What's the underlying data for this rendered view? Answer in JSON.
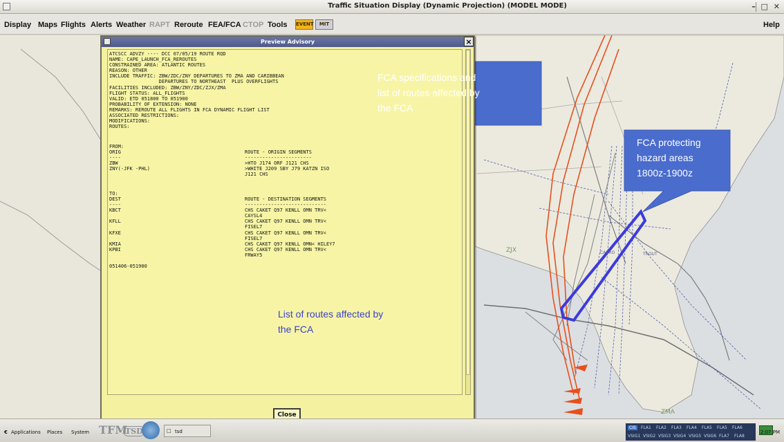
{
  "window": {
    "title": "Traffic Situation Display (Dynamic Projection) (MODEL MODE)",
    "controls": "– □ ✕"
  },
  "menubar": {
    "items": [
      {
        "label": "Display",
        "disabled": false
      },
      {
        "label": "Maps",
        "disabled": false
      },
      {
        "label": "Flights",
        "disabled": false
      },
      {
        "label": "Alerts",
        "disabled": false
      },
      {
        "label": "Weather",
        "disabled": false
      },
      {
        "label": "RAPT",
        "disabled": true
      },
      {
        "label": "Reroute",
        "disabled": false
      },
      {
        "label": "FEA/FCA",
        "disabled": false
      },
      {
        "label": "CTOP",
        "disabled": true
      },
      {
        "label": "Tools",
        "disabled": false
      }
    ],
    "tool_buttons": [
      "EVENT",
      "MIT"
    ],
    "help": "Help"
  },
  "advisory": {
    "title": "Preview Advisory",
    "header_text": "ATCSCC ADVZY ---- DCC 07/05/19 ROUTE RQD\nNAME: CAPE_LAUNCH_FCA_REROUTES\nCONSTRAINED AREA: ATLANTIC ROUTES\nREASON: OTHER\nINCLUDE TRAFFIC: ZBW/ZDC/ZNY DEPARTURES TO ZMA AND CARIBBEAN\n                 DEPARTURES TO NORTHEAST  PLUS OVERFLIGHTS\nFACILITIES INCLUDED: ZBW/ZNY/ZDC/ZJX/ZMA\nFLIGHT STATUS: ALL_FLIGHTS\nVALID: ETD 051800 TO 051900\nPROBABILITY OF EXTENSION: NONE\nREMARKS: REROUTE ALL FLIGHTS IN FCA DYNAMIC FLIGHT LIST\nASSOCIATED RESTRICTIONS:\nMODIFICATIONS:\nROUTES:",
    "from_text": "FROM:\nORIG\n----\nZBW\nZNY(-JFK -PHL)",
    "origin_routes_text": "ROUTE - ORIGIN SEGMENTS\n-----------------------\n>HTO J174 ORF J121 CHS\n>WHITE J209 SBY J79 KATZN ISO\nJ121 CHS",
    "to_text": "TO:\nDEST\n----\nKBCT\n\nKFLL\n\nKFXE\n\nKMIA\nKPBI\n\n\n051406-051900",
    "dest_routes_text": "ROUTE - DESTINATION SEGMENTS\n----------------------------\nCHS CAKET Q97 KENLL OMN TRV<\nCAYSL4\nCHS CAKET Q97 KENLL OMN TRV<\nFISEL7\nCHS CAKET Q97 KENLL OMN TRV<\nFISEL7\nCHS CAKET Q97 KENLL OMN< HILEY7\nCHS CAKET Q97 KENLL OMN TRV<\nFRWAY5",
    "close_label": "Close"
  },
  "callouts": {
    "spec": "FCA specifications and\nlist of routes affected by\nthe FCA",
    "hazard": "FCA protecting\nhazard areas\n1800z-1900z",
    "routes": "List of routes affected by\nthe FCA"
  },
  "map_labels": [
    "ZJX",
    "ZMA",
    "TROUT",
    "CABRO"
  ],
  "colors": {
    "advisory_bg": "#f4f2a0",
    "callout_blue": "#4a6ccd",
    "fca_box": "#3b3bdc",
    "route_orange": "#e5501d"
  },
  "taskbar": {
    "menus": [
      "Applications",
      "Places",
      "System"
    ],
    "task": "tsd",
    "fla_labels": [
      "CIS",
      "FLA1",
      "FLA2",
      "FLA3",
      "FLA4",
      "FLA5",
      "FLA5",
      "FLA6",
      "VSIG1",
      "VSIG2",
      "VSIG3",
      "VSIG4",
      "VSIG5",
      "VSIG6",
      "FLA7",
      "FLA8"
    ],
    "clock": "2:07 PM"
  }
}
